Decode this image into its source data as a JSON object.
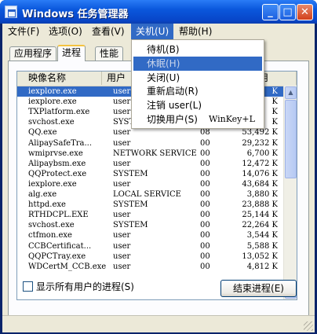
{
  "window": {
    "title": "Windows 任务管理器",
    "minimize": "_",
    "maximize": "□",
    "close": "✕"
  },
  "menubar": {
    "items": [
      "文件(F)",
      "选项(O)",
      "查看(V)",
      "关机(U)",
      "帮助(H)"
    ]
  },
  "shutdown_menu": {
    "items": [
      {
        "label": "待机(B)",
        "shortcut": ""
      },
      {
        "label": "休眠(H)",
        "shortcut": ""
      },
      {
        "label": "关闭(U)",
        "shortcut": ""
      },
      {
        "label": "重新启动(R)",
        "shortcut": ""
      },
      {
        "label": "注销 user(L)",
        "shortcut": ""
      },
      {
        "label": "切换用户(S)",
        "shortcut": "WinKey+L"
      }
    ]
  },
  "tabs": [
    "应用程序",
    "进程",
    "性能"
  ],
  "table": {
    "columns": [
      "映像名称",
      "用户",
      "",
      "用"
    ],
    "rows": [
      {
        "name": "iexplore.exe",
        "user": "user",
        "cpu": "",
        "mem": "K"
      },
      {
        "name": "iexplore.exe",
        "user": "user",
        "cpu": "",
        "mem": "K"
      },
      {
        "name": "TXPlatform.exe",
        "user": "user",
        "cpu": "",
        "mem": "K"
      },
      {
        "name": "svchost.exe",
        "user": "SYSTEM",
        "cpu": "",
        "mem": "K"
      },
      {
        "name": "QQ.exe",
        "user": "user",
        "cpu": "08",
        "mem": "53,492 K"
      },
      {
        "name": "AlipaySafeTra...",
        "user": "user",
        "cpu": "00",
        "mem": "29,232 K"
      },
      {
        "name": "wmiprvse.exe",
        "user": "NETWORK SERVICE",
        "cpu": "00",
        "mem": "6,700 K"
      },
      {
        "name": "Alipaybsm.exe",
        "user": "user",
        "cpu": "00",
        "mem": "12,472 K"
      },
      {
        "name": "QQProtect.exe",
        "user": "SYSTEM",
        "cpu": "00",
        "mem": "14,076 K"
      },
      {
        "name": "iexplore.exe",
        "user": "user",
        "cpu": "00",
        "mem": "43,684 K"
      },
      {
        "name": "alg.exe",
        "user": "LOCAL SERVICE",
        "cpu": "00",
        "mem": "3,880 K"
      },
      {
        "name": "httpd.exe",
        "user": "SYSTEM",
        "cpu": "00",
        "mem": "23,888 K"
      },
      {
        "name": "RTHDCPL.EXE",
        "user": "user",
        "cpu": "00",
        "mem": "25,144 K"
      },
      {
        "name": "svchost.exe",
        "user": "SYSTEM",
        "cpu": "00",
        "mem": "22,264 K"
      },
      {
        "name": "ctfmon.exe",
        "user": "user",
        "cpu": "00",
        "mem": "3,544 K"
      },
      {
        "name": "CCBCertificat...",
        "user": "user",
        "cpu": "00",
        "mem": "5,588 K"
      },
      {
        "name": "QQPCTray.exe",
        "user": "user",
        "cpu": "00",
        "mem": "13,052 K"
      },
      {
        "name": "WDCertM_CCB.exe",
        "user": "user",
        "cpu": "00",
        "mem": "4,812 K"
      }
    ],
    "selected_index": 0
  },
  "show_all_users_label": "显示所有用户的进程(S)",
  "end_process_label": "结束进程(E)",
  "colors": {
    "titlebar": "#0a57dc",
    "selection": "#316ac5",
    "face": "#ece9d8"
  }
}
